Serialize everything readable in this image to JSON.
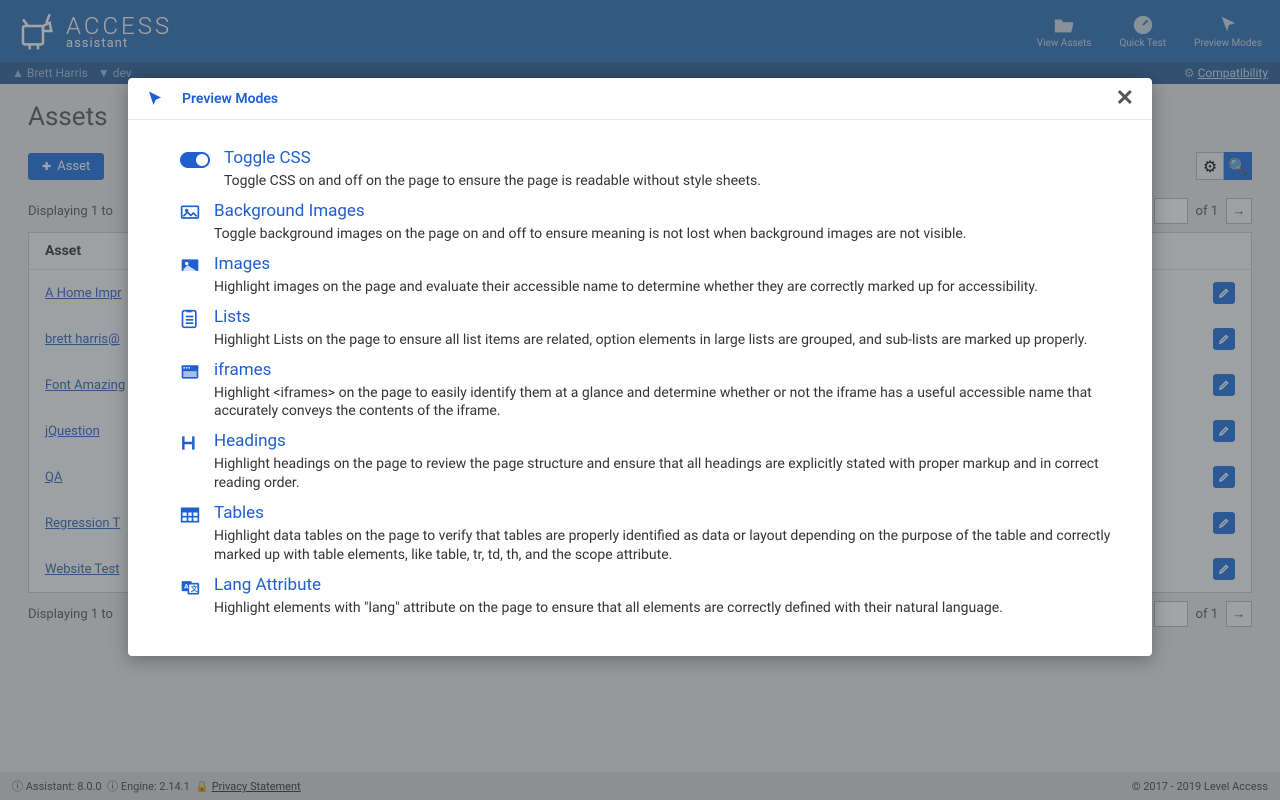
{
  "header": {
    "logo_top": "ACCESS",
    "logo_bottom": "assistant",
    "actions": [
      {
        "label": "View Assets"
      },
      {
        "label": "Quick Test"
      },
      {
        "label": "Preview Modes"
      }
    ]
  },
  "subheader": {
    "user": "Brett Harris",
    "branch": "dev",
    "compatibility": "Compatibility"
  },
  "page": {
    "title": "Assets",
    "add_button": "Asset",
    "display_text": "Displaying 1 to",
    "page_of": "of 1",
    "table_header": "Asset",
    "rows": [
      {
        "label": "A Home Impr"
      },
      {
        "label": "brett harris@"
      },
      {
        "label": "Font Amazing"
      },
      {
        "label": "jQuestion"
      },
      {
        "label": "QA"
      },
      {
        "label": "Regression T"
      },
      {
        "label": "Website Test"
      }
    ]
  },
  "footer": {
    "assistant": "Assistant: 8.0.0",
    "engine": "Engine: 2.14.1",
    "privacy": "Privacy Statement",
    "copyright": "© 2017 - 2019 Level Access"
  },
  "modal": {
    "title": "Preview Modes",
    "items": [
      {
        "title": "Toggle CSS",
        "desc": "Toggle CSS on and off on the page to ensure the page is readable without style sheets.",
        "icon": "toggle"
      },
      {
        "title": "Background Images",
        "desc": "Toggle background images on the page on and off to ensure meaning is not lost when background images are not visible.",
        "icon": "bgimage"
      },
      {
        "title": "Images",
        "desc": "Highlight images on the page and evaluate their accessible name to determine whether they are correctly marked up for accessibility.",
        "icon": "image"
      },
      {
        "title": "Lists",
        "desc": "Highlight Lists on the page to ensure all list items are related, option elements in large lists are grouped, and sub-lists are marked up properly.",
        "icon": "list"
      },
      {
        "title": "iframes",
        "desc": "Highlight <iframes> on the page to easily identify them at a glance and determine whether or not the iframe has a useful accessible name that accurately conveys the contents of the iframe.",
        "icon": "iframe"
      },
      {
        "title": "Headings",
        "desc": "Highlight headings on the page to review the page structure and ensure that all headings are explicitly stated with proper markup and in correct reading order.",
        "icon": "heading"
      },
      {
        "title": "Tables",
        "desc": "Highlight data tables on the page to verify that tables are properly identified as data or layout depending on the purpose of the table and correctly marked up with table elements, like table, tr, td, th, and the scope attribute.",
        "icon": "table"
      },
      {
        "title": "Lang Attribute",
        "desc": "Highlight elements with \"lang\" attribute on the page to ensure that all elements are correctly defined with their natural language.",
        "icon": "lang"
      }
    ]
  }
}
